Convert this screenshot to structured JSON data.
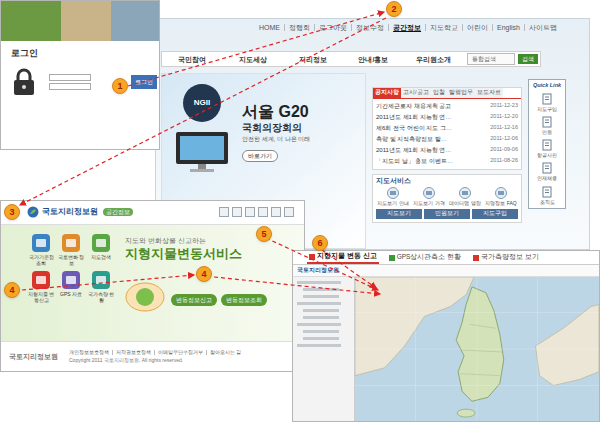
{
  "markers": [
    {
      "label": "1"
    },
    {
      "label": "2"
    },
    {
      "label": "3"
    },
    {
      "label": "4"
    },
    {
      "label": "4"
    },
    {
      "label": "5"
    },
    {
      "label": "6"
    }
  ],
  "login_window": {
    "title": "로그인",
    "button": "로그인"
  },
  "main_site": {
    "top_links": [
      {
        "label": "HOME",
        "selected": false
      },
      {
        "label": "정행회",
        "selected": false
      },
      {
        "label": "로그아웃",
        "selected": false
      },
      {
        "label": "정보수정",
        "selected": false
      },
      {
        "label": "공간정보",
        "selected": true
      },
      {
        "label": "지도학교",
        "selected": false
      },
      {
        "label": "어린이",
        "selected": false
      },
      {
        "label": "English",
        "selected": false
      },
      {
        "label": "사이트맵",
        "selected": false
      }
    ],
    "nav": [
      "국민참여",
      "지도세상",
      "지리정보",
      "안내/홍보",
      "우리원소개"
    ],
    "search": {
      "label": "통합검색",
      "button": "검색"
    },
    "banner": {
      "badge": "NGII",
      "title": "서울 G20",
      "subtitle": "국회의장회의",
      "caption": "안전한 세계, 더 나은 미래",
      "button": "바로가기"
    },
    "notice_tabs": [
      {
        "label": "공지사항",
        "selected": true
      },
      {
        "label": "고시/공고",
        "selected": false
      },
      {
        "label": "입찰",
        "selected": false
      },
      {
        "label": "발행업무",
        "selected": false
      },
      {
        "label": "보도자료",
        "selected": false
      }
    ],
    "notices": [
      {
        "title": "기간제근로자 채용계획 공고",
        "date": "2011-12-23"
      },
      {
        "title": "2011년도 제1회 지능형 연…",
        "date": "2011-12-20"
      },
      {
        "title": "제6회 전국 어린이 지도 그…",
        "date": "2011-12-16"
      },
      {
        "title": "측량 및 지적측량정보 발…",
        "date": "2011-12-06"
      },
      {
        "title": "2011년도 제1회 지능형 연…",
        "date": "2011-09-06"
      },
      {
        "title": "「지도의 날」 홍보 이벤트…",
        "date": "2011-08-26"
      }
    ],
    "map_service": {
      "title": "지도서비스",
      "items": [
        "지도보기 안내",
        "지도보기 가격",
        "데이터맵 열람",
        "지명정보 FAQ"
      ],
      "buttons": [
        "지도보기",
        "민원보기",
        "지도구입"
      ]
    },
    "quick_link": {
      "title": "Quick Link",
      "items": [
        "지도구입",
        "민원",
        "항공사진",
        "인재채용",
        "조직도"
      ]
    }
  },
  "spatial_site": {
    "logo": "국토지리정보원",
    "badge": "공간정보",
    "icons": [
      "국가기준점 조회",
      "국토변화 정보",
      "지도검색",
      "지형지물 변동신고",
      "GPS 자료",
      "국가측량 현황"
    ],
    "hero_line": "지도와 변화상을 신고하는",
    "hero_title": "지형지물변동서비스",
    "buttons": [
      "변동정보신고",
      "변동정보조회"
    ],
    "footer_logo": "국토지리정보원",
    "footer_links": [
      "개인정보보호정책",
      "저작권보호정책",
      "이메일무단수집거부",
      "찾아오시는 길"
    ],
    "copyright": "Copyright 2011 국토지리정보원. All rights reserved."
  },
  "map_window": {
    "tabs": [
      {
        "label": "지형지물 변동 신고",
        "selected": true,
        "color": "#d9342b"
      },
      {
        "label": "GPS상시관측소 현황",
        "selected": false,
        "color": "#3a9a3a"
      },
      {
        "label": "국가측량정보 보기",
        "selected": false,
        "color": "#d9342b"
      }
    ],
    "logo": "국토지리정보원"
  }
}
